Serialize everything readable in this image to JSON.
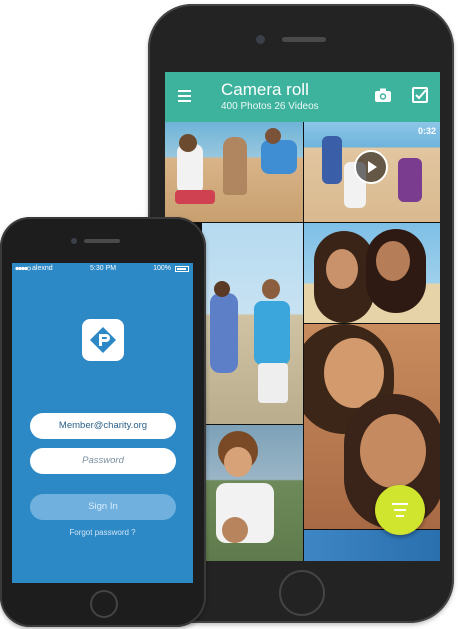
{
  "gallery_app": {
    "title": "Camera roll",
    "subtitle": "400 Photos 26 Videos",
    "video_duration": "0:32",
    "icons": [
      "menu-icon",
      "camera-icon",
      "select-check-icon",
      "play-icon",
      "filter-icon"
    ],
    "colors": {
      "app_bar": "#3db39e",
      "fab": "#cfe52e"
    }
  },
  "login_app": {
    "status": {
      "carrier": "alexnd",
      "time": "5:30 PM",
      "battery": "100%"
    },
    "email_value": "Member@charity.org",
    "password_placeholder": "Password",
    "sign_in_label": "Sign In",
    "forgot_label": "Forgot password ?",
    "colors": {
      "background": "#2d88c6",
      "button": "#6fb0de"
    }
  }
}
